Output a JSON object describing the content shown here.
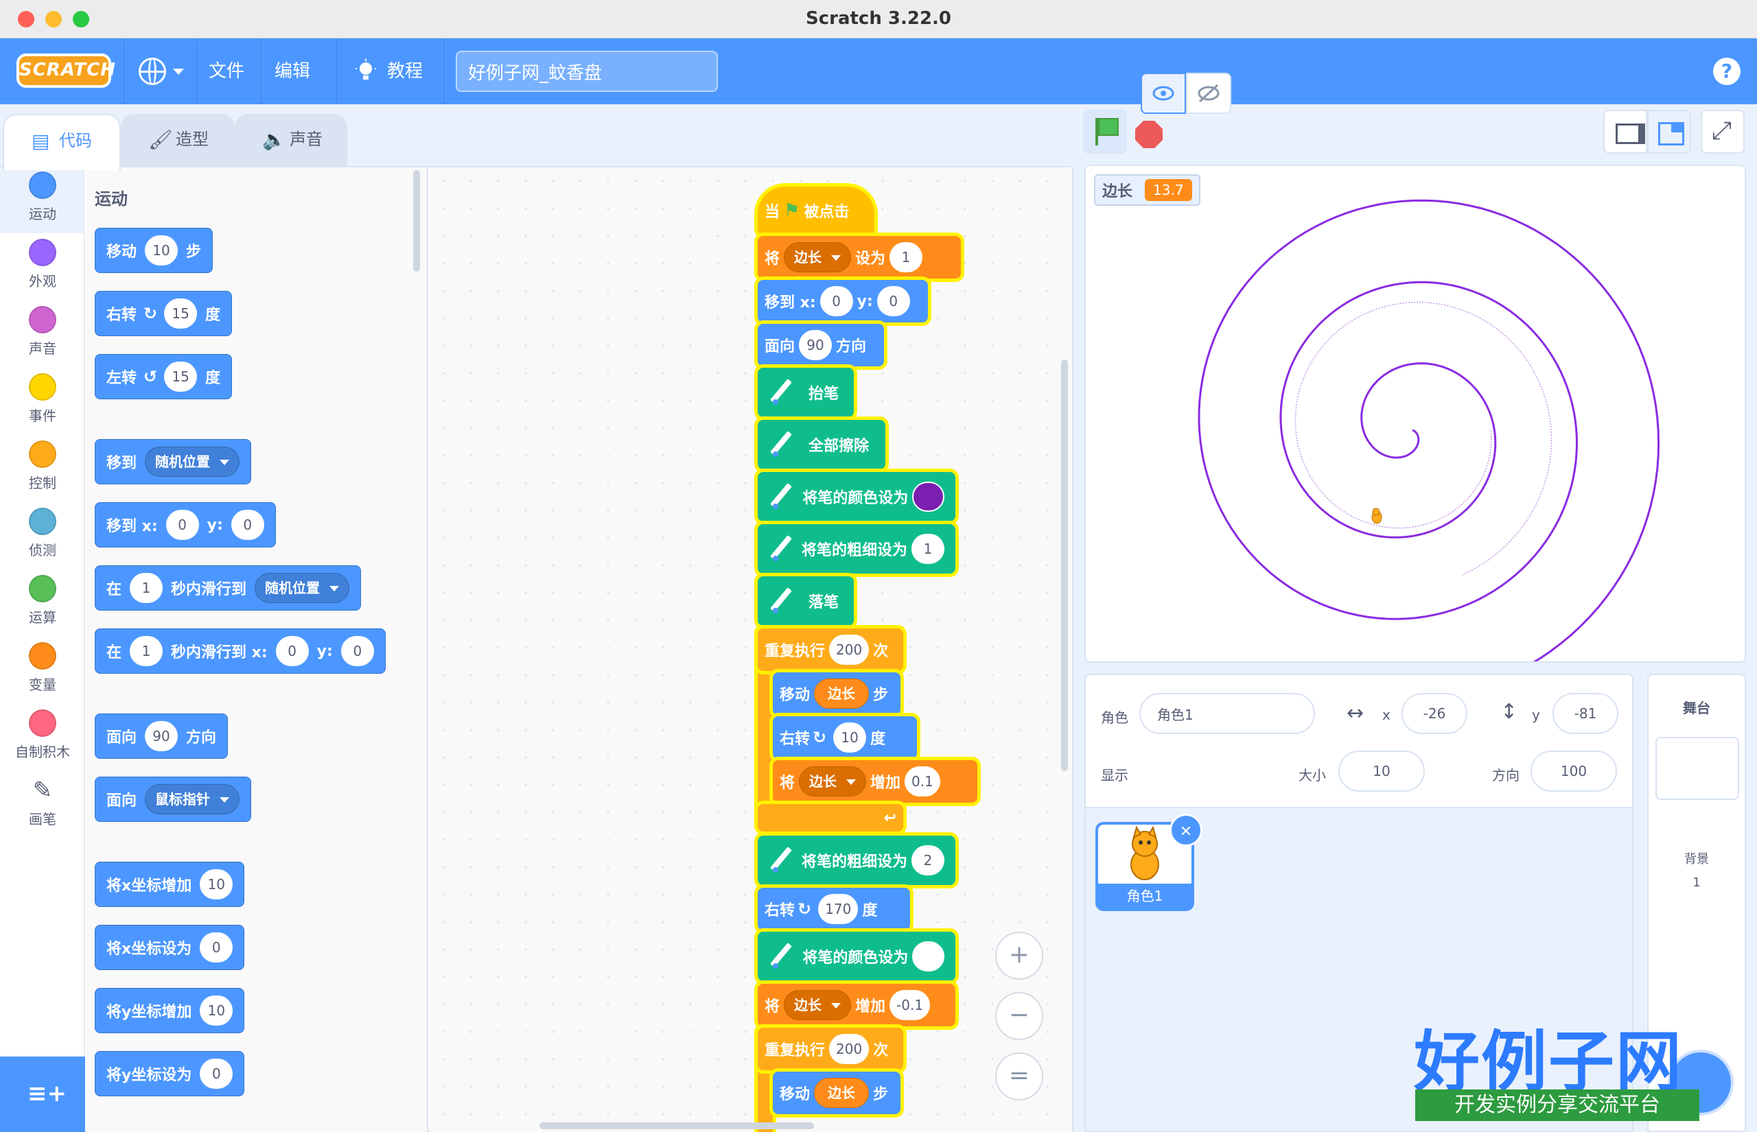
{
  "window": {
    "title": "Scratch 3.22.0"
  },
  "menubar": {
    "logo": "SCRATCH",
    "file": "文件",
    "edit": "编辑",
    "tutorials": "教程",
    "project_title": "好例子网_蚊香盘",
    "help": "?"
  },
  "tabs": {
    "code": "代码",
    "costumes": "造型",
    "sounds": "声音"
  },
  "categories": [
    {
      "label": "运动",
      "color": "#4c97ff"
    },
    {
      "label": "外观",
      "color": "#9966ff"
    },
    {
      "label": "声音",
      "color": "#cf63cf"
    },
    {
      "label": "事件",
      "color": "#ffd500"
    },
    {
      "label": "控制",
      "color": "#ffab19"
    },
    {
      "label": "侦测",
      "color": "#5cb1d6"
    },
    {
      "label": "运算",
      "color": "#59c059"
    },
    {
      "label": "变量",
      "color": "#ff8c1a"
    },
    {
      "label": "自制积木",
      "color": "#ff6680"
    },
    {
      "label": "画笔",
      "color": "#0fbd8c"
    }
  ],
  "palette": {
    "header": "运动",
    "move": {
      "a": "移动",
      "n": "10",
      "b": "步"
    },
    "turn_right": {
      "a": "右转",
      "n": "15",
      "b": "度"
    },
    "turn_left": {
      "a": "左转",
      "n": "15",
      "b": "度"
    },
    "goto_random": {
      "a": "移到",
      "d": "随机位置"
    },
    "goto_xy": {
      "a": "移到 x:",
      "x": "0",
      "y_label": "y:",
      "y": "0"
    },
    "glide_random": {
      "a": "在",
      "n": "1",
      "b": "秒内滑行到",
      "d": "随机位置"
    },
    "glide_xy": {
      "a": "在",
      "n": "1",
      "b": "秒内滑行到 x:",
      "x": "0",
      "y_label": "y:",
      "y": "0"
    },
    "point_dir": {
      "a": "面向",
      "n": "90",
      "b": "方向"
    },
    "point_towards": {
      "a": "面向",
      "d": "鼠标指针"
    },
    "change_x": {
      "a": "将x坐标增加",
      "n": "10"
    },
    "set_x": {
      "a": "将x坐标设为",
      "n": "0"
    },
    "change_y": {
      "a": "将y坐标增加",
      "n": "10"
    },
    "set_y": {
      "a": "将y坐标设为",
      "n": "0"
    }
  },
  "script": {
    "hat": {
      "a": "当",
      "b": "被点击"
    },
    "set_var": {
      "a": "将",
      "d": "边长",
      "b": "设为",
      "n": "1"
    },
    "goto": {
      "a": "移到 x:",
      "x": "0",
      "y_label": "y:",
      "y": "0"
    },
    "point": {
      "a": "面向",
      "n": "90",
      "b": "方向"
    },
    "pen_up": "抬笔",
    "clear": "全部擦除",
    "pen_color": {
      "a": "将笔的颜色设为",
      "color": "#7a1fb0"
    },
    "pen_size": {
      "a": "将笔的粗细设为",
      "n": "1"
    },
    "pen_down": "落笔",
    "repeat1": {
      "a": "重复执行",
      "n": "200",
      "b": "次"
    },
    "move_var": {
      "a": "移动",
      "r": "边长",
      "b": "步"
    },
    "turn10": {
      "a": "右转",
      "n": "10",
      "b": "度"
    },
    "change_var": {
      "a": "将",
      "d": "边长",
      "b": "增加",
      "n": "0.1"
    },
    "pen_size2": {
      "a": "将笔的粗细设为",
      "n": "2"
    },
    "turn170": {
      "a": "右转",
      "n": "170",
      "b": "度"
    },
    "pen_color2": {
      "a": "将笔的颜色设为",
      "color": "#ffffff"
    },
    "change_var2": {
      "a": "将",
      "d": "边长",
      "b": "增加",
      "n": "-0.1"
    },
    "repeat2": {
      "a": "重复执行",
      "n": "200",
      "b": "次"
    },
    "move_var2": {
      "a": "移动",
      "r": "边长",
      "b": "步"
    }
  },
  "zoom": {
    "in": "+",
    "out": "−",
    "reset": "="
  },
  "stage": {
    "monitor_label": "边长",
    "monitor_value": "13.7"
  },
  "sprite_info": {
    "sprite_label": "角色",
    "sprite_name": "角色1",
    "x_label": "x",
    "x": "-26",
    "y_label": "y",
    "y": "-81",
    "show_label": "显示",
    "size_label": "大小",
    "size": "10",
    "direction_label": "方向",
    "direction": "100"
  },
  "sprite_list": [
    {
      "name": "角色1"
    }
  ],
  "stage_pane": {
    "title": "舞台",
    "backdrop_label": "背景",
    "backdrop_count": "1"
  },
  "watermark": {
    "title": "好例子网",
    "subtitle": "开发实例分享交流平台"
  }
}
